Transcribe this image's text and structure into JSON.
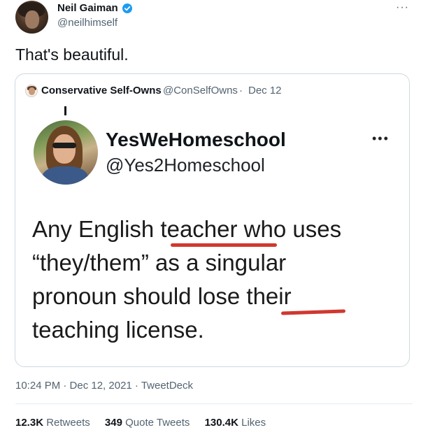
{
  "tweet": {
    "author_name": "Neil Gaiman",
    "author_handle": "@neilhimself",
    "more_icon": "more-icon",
    "text": "That's beautiful.",
    "timestamp": "10:24 PM · Dec 12, 2021 · TweetDeck"
  },
  "quote": {
    "author_name": "Conservative Self-Owns",
    "author_handle": "@ConSelfOwns",
    "separator": "·",
    "date": "Dec 12",
    "image": {
      "account_name": "YesWeHomeschool",
      "account_handle": "@Yes2Homeschool",
      "more_icon": "more-icon",
      "lines": [
        "Any English teacher who uses",
        "“they/them” as a singular",
        "pronoun should lose their",
        "teaching license."
      ],
      "underline_color": "#d0382e"
    }
  },
  "stats": {
    "retweets_count": "12.3K",
    "retweets_label": "Retweets",
    "quotes_count": "349",
    "quotes_label": "Quote Tweets",
    "likes_count": "130.4K",
    "likes_label": "Likes"
  },
  "colors": {
    "verified_badge": "#1d9bf0",
    "secondary_text": "#536471",
    "border": "#cfd9de"
  }
}
